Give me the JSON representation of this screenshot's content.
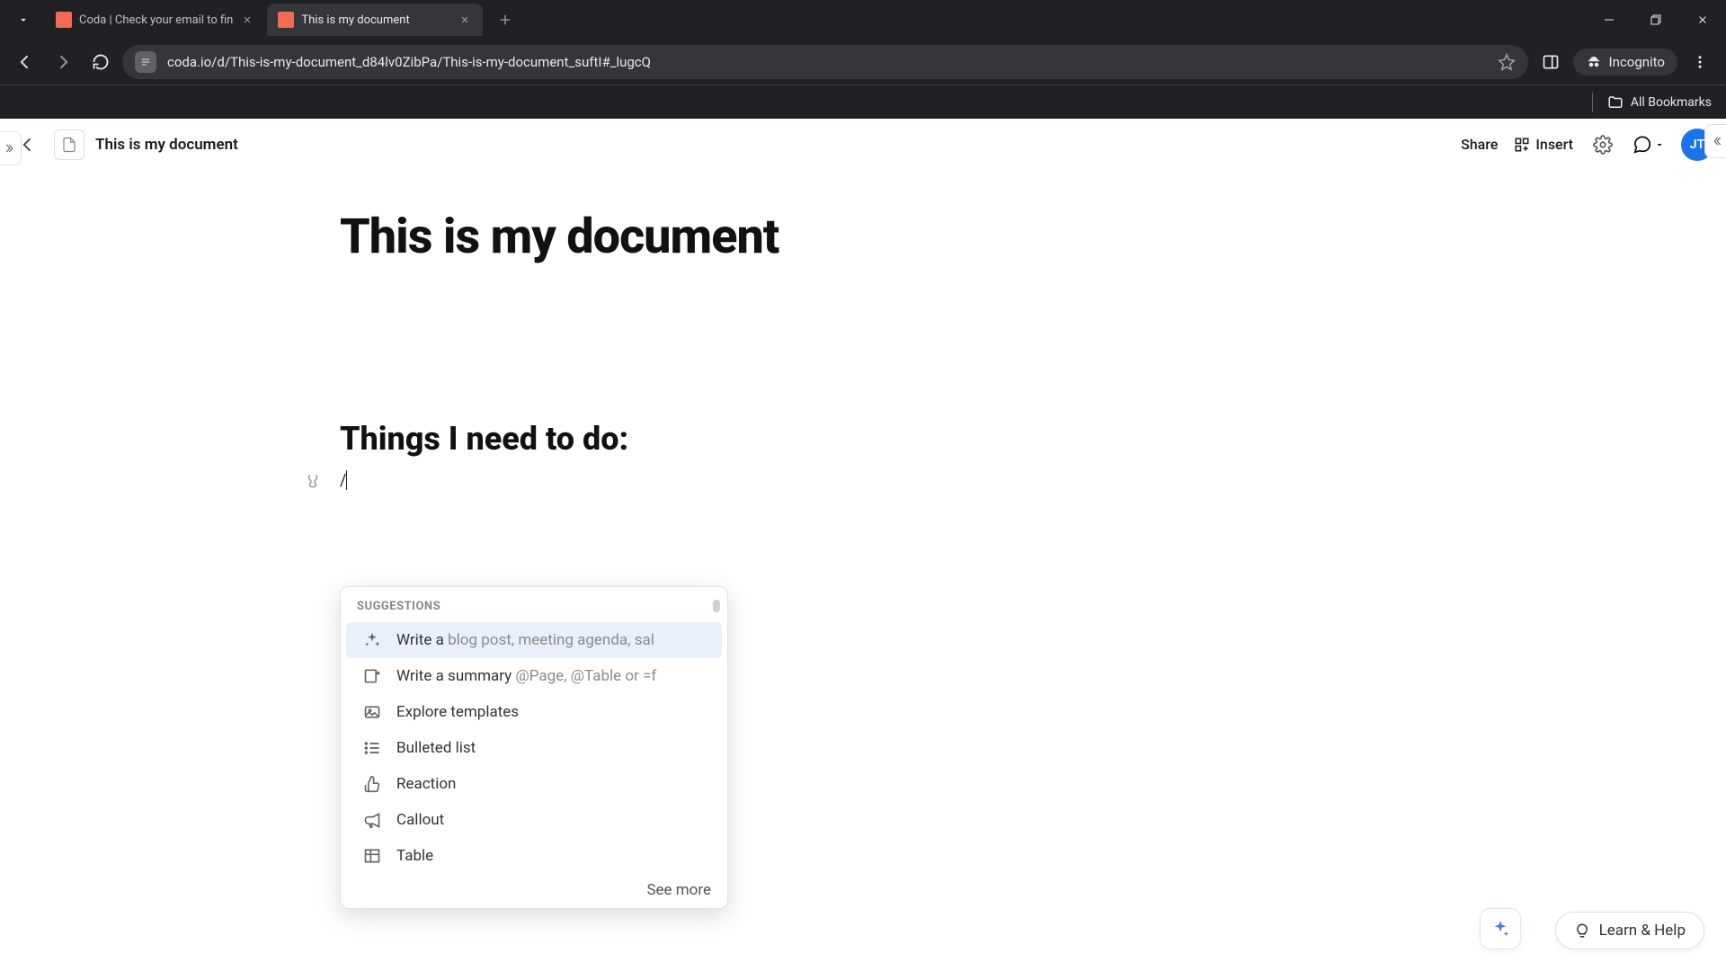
{
  "browser": {
    "tabs": [
      {
        "title": "Coda | Check your email to fin",
        "active": false
      },
      {
        "title": "This is my document",
        "active": true
      }
    ],
    "url": "coda.io/d/This-is-my-document_d84lv0ZibPa/This-is-my-document_suftI#_lugcQ",
    "incognitoLabel": "Incognito",
    "allBookmarks": "All Bookmarks"
  },
  "header": {
    "docTitle": "This is my document",
    "share": "Share",
    "insert": "Insert",
    "avatar": "JT"
  },
  "document": {
    "h1": "This is my document",
    "h2": "Things I need to do:",
    "slashText": "/"
  },
  "suggestions": {
    "header": "SUGGESTIONS",
    "items": [
      {
        "label": "Write a ",
        "greyLabel": "blog post, meeting agenda, sal",
        "icon": "sparkle"
      },
      {
        "label": "Write a summary ",
        "greyLabel": "@Page, @Table or =f",
        "icon": "summary"
      },
      {
        "label": "Explore templates",
        "greyLabel": "",
        "icon": "image"
      },
      {
        "label": "Bulleted list",
        "greyLabel": "",
        "icon": "list"
      },
      {
        "label": "Reaction",
        "greyLabel": "",
        "icon": "thumbs-up"
      },
      {
        "label": "Callout",
        "greyLabel": "",
        "icon": "megaphone"
      },
      {
        "label": "Table",
        "greyLabel": "",
        "icon": "table"
      }
    ],
    "seeMore": "See more"
  },
  "footer": {
    "learnHelp": "Learn & Help"
  }
}
